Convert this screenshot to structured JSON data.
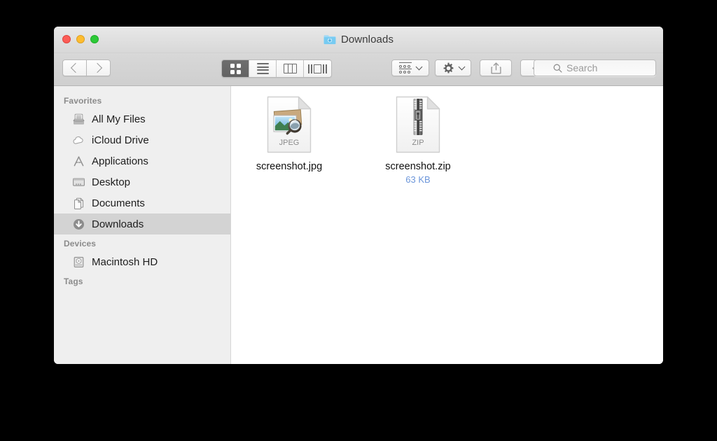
{
  "window": {
    "title": "Downloads",
    "title_icon": "downloads-folder-icon",
    "traffic_lights": {
      "close_color": "#fc5d57",
      "minimize_color": "#fdbc2f",
      "maximize_color": "#2cc937"
    }
  },
  "toolbar": {
    "back_label": "Back",
    "forward_label": "Forward",
    "view_modes": [
      {
        "name": "icon-view",
        "label": "Icon View",
        "selected": true
      },
      {
        "name": "list-view",
        "label": "List View",
        "selected": false
      },
      {
        "name": "column-view",
        "label": "Column View",
        "selected": false
      },
      {
        "name": "coverflow-view",
        "label": "Cover Flow View",
        "selected": false
      }
    ],
    "arrange_label": "Arrange",
    "action_label": "Action",
    "share_label": "Share",
    "tag_label": "Edit Tags"
  },
  "search": {
    "placeholder": "Search",
    "value": "",
    "icon": "search-icon"
  },
  "sidebar": {
    "sections": [
      {
        "header": "Favorites",
        "items": [
          {
            "label": "All My Files",
            "icon": "all-my-files-icon",
            "selected": false
          },
          {
            "label": "iCloud Drive",
            "icon": "icloud-drive-icon",
            "selected": false
          },
          {
            "label": "Applications",
            "icon": "applications-icon",
            "selected": false
          },
          {
            "label": "Desktop",
            "icon": "desktop-icon",
            "selected": false
          },
          {
            "label": "Documents",
            "icon": "documents-icon",
            "selected": false
          },
          {
            "label": "Downloads",
            "icon": "downloads-icon",
            "selected": true
          }
        ]
      },
      {
        "header": "Devices",
        "items": [
          {
            "label": "Macintosh HD",
            "icon": "hard-drive-icon",
            "selected": false
          }
        ]
      },
      {
        "header": "Tags",
        "items": []
      }
    ]
  },
  "content": {
    "files": [
      {
        "name": "screenshot.jpg",
        "size": "",
        "kind_label": "JPEG",
        "icon": "jpeg-document-icon"
      },
      {
        "name": "screenshot.zip",
        "size": "63 KB",
        "kind_label": "ZIP",
        "icon": "zip-document-icon"
      }
    ]
  },
  "colors": {
    "selection_gray": "#d3d3d3",
    "size_blue": "#6c96da",
    "sidebar_bg": "#efefef",
    "content_bg": "#ffffff"
  }
}
